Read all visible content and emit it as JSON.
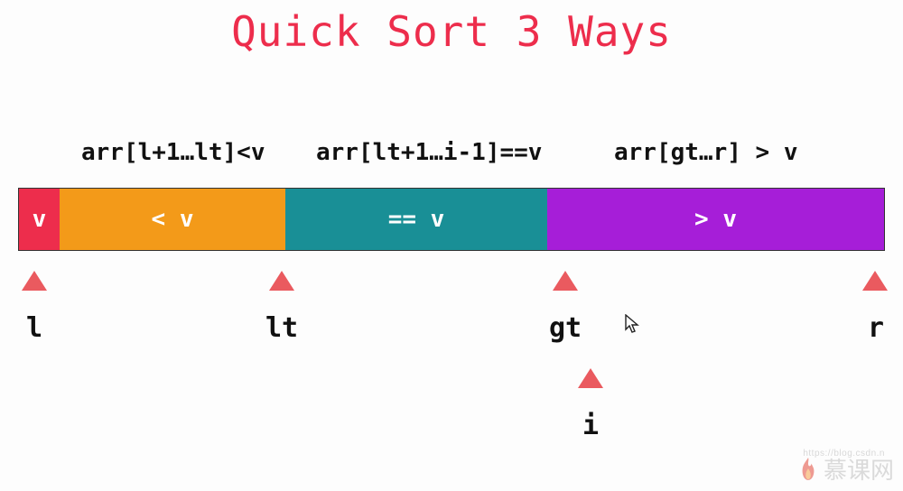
{
  "colors": {
    "red": "#ED2D4C",
    "orange": "#F39A19",
    "teal": "#198F96",
    "purple": "#A61ED8",
    "triangle": "#EA5A5F"
  },
  "title": "Quick Sort 3 Ways",
  "formulas": {
    "left": "arr[l+1…lt]<v",
    "middle": "arr[lt+1…i-1]==v",
    "right": "arr[gt…r] > v"
  },
  "segments": {
    "pivot": "v",
    "less": "< v",
    "equal": "== v",
    "greater": "> v"
  },
  "pointers": {
    "l": "l",
    "lt": "lt",
    "gt": "gt",
    "r": "r",
    "i": "i"
  },
  "watermark": {
    "site": "慕课网",
    "url": "https://blog.csdn.n"
  }
}
